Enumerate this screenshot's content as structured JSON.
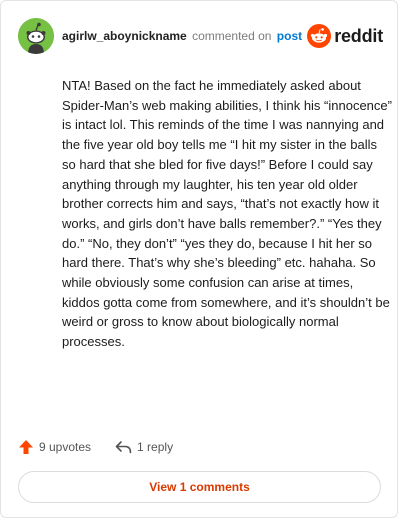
{
  "header": {
    "username": "agirlw_aboynickname",
    "commented_text": "commented on",
    "post_link": "post",
    "brand_name": "reddit"
  },
  "comment": {
    "text": "NTA! Based on the fact he immediately asked about Spider-Man’s web making abilities, I think his “innocence” is intact lol. This reminds of the time I was nannying and the five year old boy tells me “I hit my sister in the balls so hard that she bled for five days!” Before I could say anything through my laughter, his ten year old older brother corrects him and says, “that’s not exactly how it works, and girls don’t have balls remember?.” “Yes they do.” “No, they don’t” “yes they do, because I hit her so hard there. That’s why she’s bleeding” etc. hahaha. So while obviously some confusion can arise at times, kiddos gotta come from somewhere, and it’s shouldn’t be weird or gross to know about biologically normal processes."
  },
  "actions": {
    "upvotes_label": "9 upvotes",
    "reply_label": "1 reply"
  },
  "footer": {
    "view_comments_label": "View 1 comments"
  },
  "colors": {
    "accent": "#ff4500",
    "link": "#0079d3",
    "avatar_bg": "#76c043",
    "view_button_text": "#d93a00"
  },
  "icons": {
    "avatar": "snoo-avatar-icon",
    "brand": "reddit-logo-icon",
    "upvote": "upvote-arrow-icon",
    "reply": "reply-arrow-icon"
  }
}
